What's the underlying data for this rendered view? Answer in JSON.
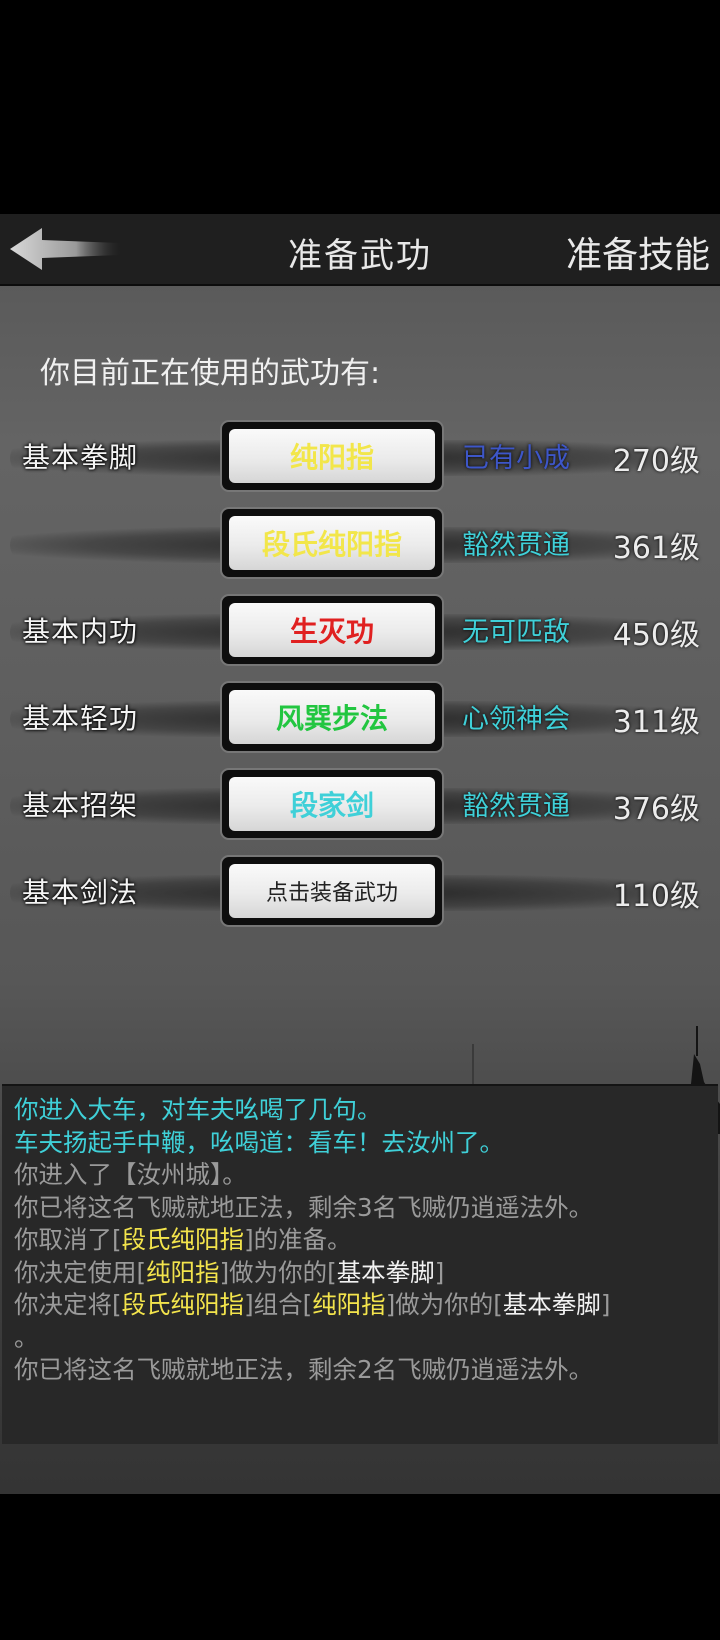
{
  "header": {
    "title": "准备武功",
    "skills_link": "准备技能"
  },
  "prompt": "你目前正在使用的武功有:",
  "rows": [
    {
      "category": "基本拳脚",
      "skill": "纯阳指",
      "skill_color": "#f2e64a",
      "mastery": "已有小成",
      "mastery_color": "#3d56c8",
      "level": "270级"
    },
    {
      "category": "",
      "skill": "段氏纯阳指",
      "skill_color": "#f2e64a",
      "mastery": "豁然贯通",
      "mastery_color": "#3fd0d8",
      "level": "361级"
    },
    {
      "category": "基本内功",
      "skill": "生灭功",
      "skill_color": "#e02020",
      "mastery": "无可匹敌",
      "mastery_color": "#3fd0d8",
      "level": "450级"
    },
    {
      "category": "基本轻功",
      "skill": "风巽步法",
      "skill_color": "#22c640",
      "mastery": "心领神会",
      "mastery_color": "#3fd0d8",
      "level": "311级"
    },
    {
      "category": "基本招架",
      "skill": "段家剑",
      "skill_color": "#3fd0d8",
      "mastery": "豁然贯通",
      "mastery_color": "#3fd0d8",
      "level": "376级"
    },
    {
      "category": "基本剑法",
      "skill": "点击装备武功",
      "skill_color": "#222222",
      "mastery": "",
      "mastery_color": "#3fd0d8",
      "level": "110级"
    }
  ],
  "log": {
    "l1": "你进入大车，对车夫吆喝了几句。",
    "l2": "车夫扬起手中鞭，吆喝道：看车！去汝州了。",
    "l3": "你进入了【汝州城】。",
    "l4": "你已将这名飞贼就地正法，剩余3名飞贼仍逍遥法外。",
    "l5a": "你取消了[",
    "l5b": "段氏纯阳指",
    "l5c": "]的准备。",
    "l6a": "你决定使用[",
    "l6b": "纯阳指",
    "l6c": "]做为你的[",
    "l6d": "基本拳脚",
    "l6e": "]",
    "l7a": "你决定将[",
    "l7b": "段氏纯阳指",
    "l7c": "]组合[",
    "l7d": "纯阳指",
    "l7e": "]做为你的[",
    "l7f": "基本拳脚",
    "l7g": "]",
    "l8": "。",
    "l9": "你已将这名飞贼就地正法，剩余2名飞贼仍逍遥法外。"
  },
  "icons": {
    "back": "back-arrow-icon"
  }
}
